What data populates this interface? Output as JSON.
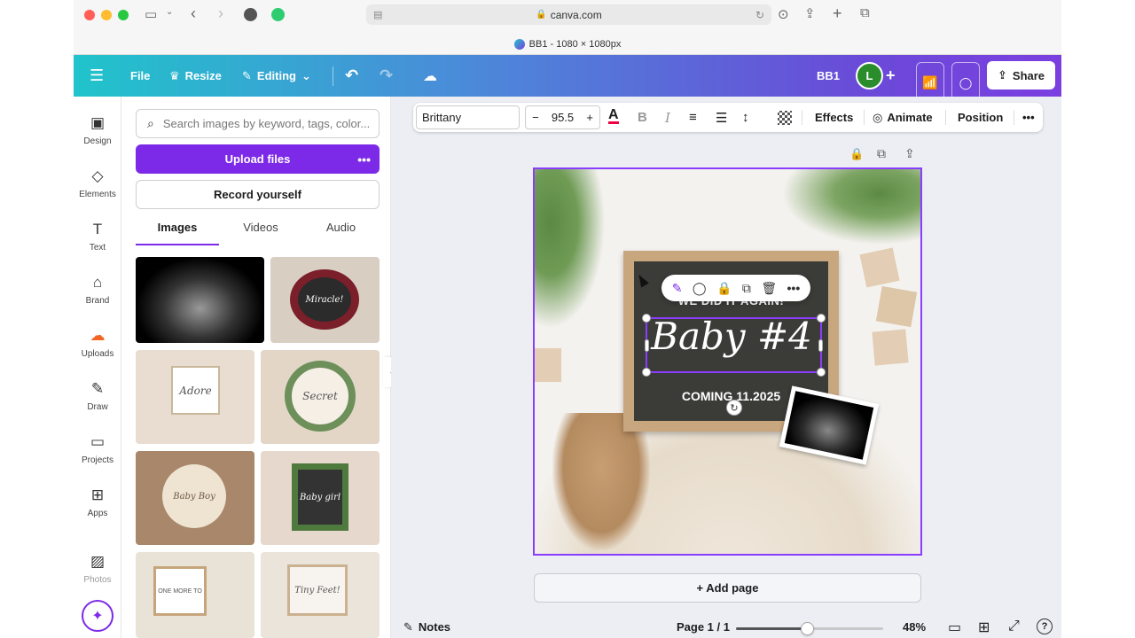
{
  "browser": {
    "url": "canva.com",
    "tab_title": "BB1 - 1080 × 1080px"
  },
  "topbar": {
    "file": "File",
    "resize": "Resize",
    "editing": "Editing",
    "doc_name": "BB1",
    "avatar_letter": "L",
    "share": "Share"
  },
  "rail": {
    "items": [
      {
        "label": "Design",
        "icon": "design-icon"
      },
      {
        "label": "Elements",
        "icon": "elements-icon"
      },
      {
        "label": "Text",
        "icon": "text-icon"
      },
      {
        "label": "Brand",
        "icon": "brand-icon"
      },
      {
        "label": "Uploads",
        "icon": "uploads-icon"
      },
      {
        "label": "Draw",
        "icon": "draw-icon"
      },
      {
        "label": "Projects",
        "icon": "projects-icon"
      },
      {
        "label": "Apps",
        "icon": "apps-icon"
      },
      {
        "label": "Photos",
        "icon": "photos-icon"
      }
    ]
  },
  "panel": {
    "search_placeholder": "Search images by keyword, tags, color...",
    "upload_label": "Upload files",
    "record_label": "Record yourself",
    "tabs": [
      "Images",
      "Videos",
      "Audio"
    ],
    "active_tab": "Images",
    "thumb_texts": [
      "Miracle!",
      "Adore",
      "Secret",
      "Baby Boy",
      "Baby girl",
      "Tiny Feet!",
      "ONE MORE TO"
    ]
  },
  "context_toolbar": {
    "font": "Brittany",
    "font_size": "95.5",
    "minus": "−",
    "plus": "+",
    "effects": "Effects",
    "animate": "Animate",
    "position": "Position"
  },
  "canvas": {
    "line1": "WE DID IT AGAIN!",
    "line2": "Baby #4",
    "line3": "COMING 11.2025"
  },
  "editor": {
    "add_page": "+ Add page",
    "notes": "Notes",
    "page_indicator": "Page 1 / 1",
    "zoom": "48%",
    "zoom_fraction": 0.48
  },
  "colors": {
    "accent": "#7d2ae8",
    "selection": "#8b3dff",
    "avatar": "#2a8c2a"
  }
}
